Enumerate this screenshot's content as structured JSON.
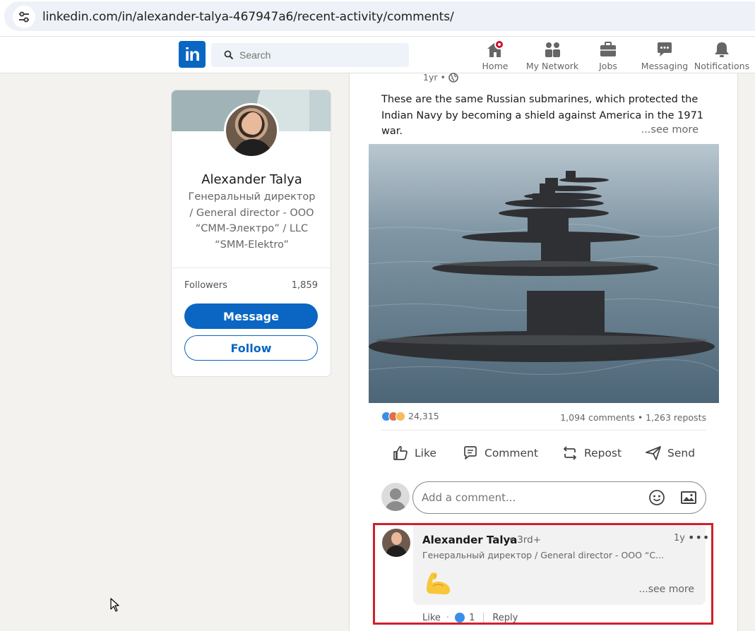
{
  "browser": {
    "url": "linkedin.com/in/alexander-talya-467947a6/recent-activity/comments/"
  },
  "nav": {
    "logo": "in",
    "search_placeholder": "Search",
    "items": [
      {
        "label": "Home"
      },
      {
        "label": "My Network"
      },
      {
        "label": "Jobs"
      },
      {
        "label": "Messaging"
      },
      {
        "label": "Notifications"
      }
    ]
  },
  "profile": {
    "name": "Alexander Talya",
    "headline": "Генеральный директор / General director - ООО “СММ-Электро” / LLC “SMM-Elektro”",
    "followers_label": "Followers",
    "followers_value": "1,859",
    "message_label": "Message",
    "follow_label": "Follow"
  },
  "post": {
    "time": "1yr •",
    "text": "These are the same Russian submarines, which protected the Indian Navy by becoming a shield against America in the 1971 war.",
    "see_more": "...see more",
    "reaction_count": "24,315",
    "stats": "1,094 comments • 1,263 reposts",
    "actions": {
      "like": "Like",
      "comment": "Comment",
      "repost": "Repost",
      "send": "Send"
    },
    "comment_placeholder": "Add a comment..."
  },
  "comment": {
    "author": "Alexander Talya",
    "degree": "• 3rd+",
    "time": "1y",
    "more": "•••",
    "headline": "Генеральный директор / General director - ООО “С...",
    "see_more": "...see more",
    "like_label": "Like",
    "dot": "·",
    "like_count": "1",
    "reply_label": "Reply"
  },
  "colors": {
    "linkedin_blue": "#0a66c2",
    "highlight_red": "#d1202a",
    "page_bg": "#f4f2ee"
  }
}
